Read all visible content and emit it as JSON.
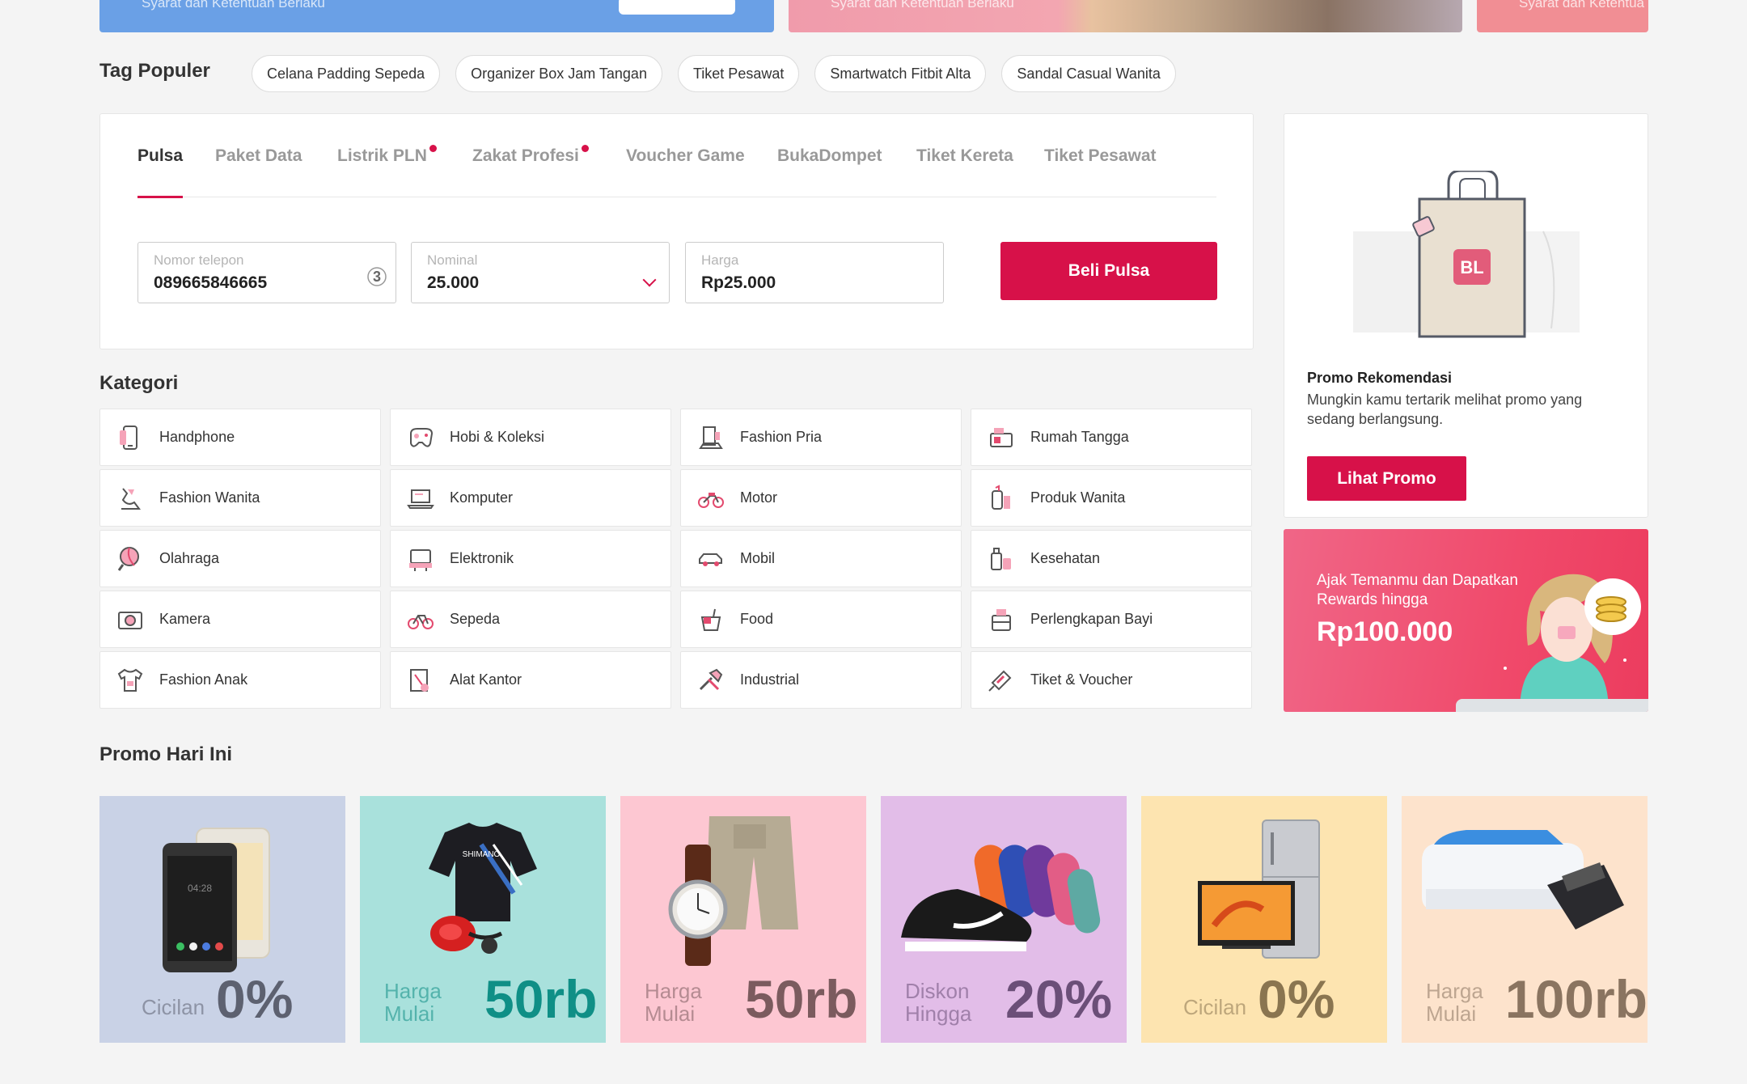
{
  "banners": [
    {
      "text": "Syarat dan Ketentuan Berlaku"
    },
    {
      "text": "Syarat dan Ketentuan Berlaku"
    },
    {
      "text": "Syarat dan Ketentua"
    }
  ],
  "tag_populer": {
    "title": "Tag Populer",
    "tags": [
      "Celana Padding Sepeda",
      "Organizer Box Jam Tangan",
      "Tiket Pesawat",
      "Smartwatch Fitbit Alta",
      "Sandal Casual Wanita"
    ]
  },
  "pulsa": {
    "tabs": [
      {
        "label": "Pulsa",
        "active": true,
        "dot": false
      },
      {
        "label": "Paket Data",
        "active": false,
        "dot": false
      },
      {
        "label": "Listrik PLN",
        "active": false,
        "dot": true
      },
      {
        "label": "Zakat Profesi",
        "active": false,
        "dot": true
      },
      {
        "label": "Voucher Game",
        "active": false,
        "dot": false
      },
      {
        "label": "BukaDompet",
        "active": false,
        "dot": false
      },
      {
        "label": "Tiket Kereta",
        "active": false,
        "dot": false
      },
      {
        "label": "Tiket Pesawat",
        "active": false,
        "dot": false
      }
    ],
    "phone_label": "Nomor telepon",
    "phone_value": "089665846665",
    "provider_icon": "tri-provider-icon",
    "nominal_label": "Nominal",
    "nominal_value": "25.000",
    "harga_label": "Harga",
    "harga_value": "Rp25.000",
    "buy_label": "Beli Pulsa"
  },
  "kategori": {
    "title": "Kategori",
    "items": [
      {
        "label": "Handphone",
        "icon": "phone-icon"
      },
      {
        "label": "Hobi & Koleksi",
        "icon": "gamepad-icon"
      },
      {
        "label": "Fashion Pria",
        "icon": "men-fashion-icon"
      },
      {
        "label": "Rumah Tangga",
        "icon": "home-appliance-icon"
      },
      {
        "label": "Fashion Wanita",
        "icon": "women-fashion-icon"
      },
      {
        "label": "Komputer",
        "icon": "laptop-icon"
      },
      {
        "label": "Motor",
        "icon": "motorcycle-icon"
      },
      {
        "label": "Produk Wanita",
        "icon": "cosmetics-icon"
      },
      {
        "label": "Olahraga",
        "icon": "sports-icon"
      },
      {
        "label": "Elektronik",
        "icon": "tv-icon"
      },
      {
        "label": "Mobil",
        "icon": "car-icon"
      },
      {
        "label": "Kesehatan",
        "icon": "health-icon"
      },
      {
        "label": "Kamera",
        "icon": "camera-icon"
      },
      {
        "label": "Sepeda",
        "icon": "bicycle-icon"
      },
      {
        "label": "Food",
        "icon": "food-icon"
      },
      {
        "label": "Perlengkapan Bayi",
        "icon": "baby-icon"
      },
      {
        "label": "Fashion Anak",
        "icon": "kids-fashion-icon"
      },
      {
        "label": "Alat Kantor",
        "icon": "office-icon"
      },
      {
        "label": "Industrial",
        "icon": "tools-icon"
      },
      {
        "label": "Tiket & Voucher",
        "icon": "ticket-icon"
      }
    ]
  },
  "promo_rekomendasi": {
    "badge": "BL",
    "title": "Promo Rekomendasi",
    "desc": "Mungkin kamu tertarik melihat promo yang sedang berlangsung.",
    "button": "Lihat Promo"
  },
  "referral": {
    "line1": "Ajak Temanmu dan Dapatkan Rewards hingga",
    "amount": "Rp100.000"
  },
  "promo_hari_ini": {
    "title": "Promo Hari Ini",
    "cards": [
      {
        "small": "Cicilan",
        "big": "0%",
        "bg": "#c9d2e6",
        "fg": "#5d6170",
        "image": "smartphones"
      },
      {
        "small": "Harga Mulai",
        "big": "50rb",
        "bg": "#a9e1dc",
        "fg": "#0f8f86",
        "image": "cycling-jersey"
      },
      {
        "small": "Harga Mulai",
        "big": "50rb",
        "bg": "#fdc7d2",
        "fg": "#7b5b5e",
        "image": "watch-shorts"
      },
      {
        "small": "Diskon Hingga",
        "big": "20%",
        "bg": "#e2bde8",
        "fg": "#6b4f78",
        "image": "shoes-mats"
      },
      {
        "small": "Cicilan",
        "big": "0%",
        "bg": "#fde4b0",
        "fg": "#8a7550",
        "image": "tv-fridge"
      },
      {
        "small": "Harga Mulai",
        "big": "100rb",
        "bg": "#fde3cc",
        "fg": "#8a7460",
        "image": "printers"
      }
    ]
  },
  "colors": {
    "accent": "#d71149",
    "background": "#f4f4f4"
  }
}
